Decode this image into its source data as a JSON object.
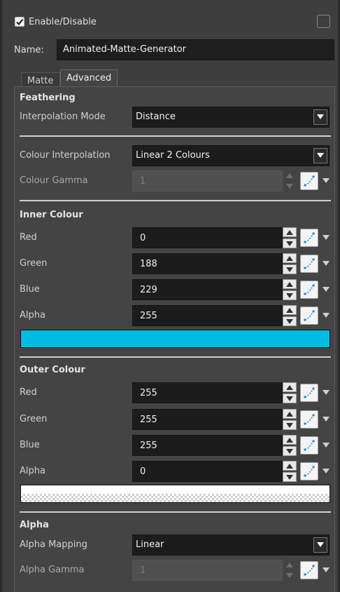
{
  "header": {
    "enable_label": "Enable/Disable",
    "enable_checked": true,
    "name_label": "Name:",
    "name_value": "Animated-Matte-Generator"
  },
  "tabs": [
    {
      "label": "Matte",
      "active": false
    },
    {
      "label": "Advanced",
      "active": true
    }
  ],
  "feathering": {
    "title": "Feathering",
    "interpolation_mode_label": "Interpolation Mode",
    "interpolation_mode_value": "Distance"
  },
  "colour": {
    "interpolation_label": "Colour Interpolation",
    "interpolation_value": "Linear 2 Colours",
    "gamma_label": "Colour Gamma",
    "gamma_value": "1"
  },
  "inner_colour": {
    "title": "Inner Colour",
    "red_label": "Red",
    "red": "0",
    "green_label": "Green",
    "green": "188",
    "blue_label": "Blue",
    "blue": "229",
    "alpha_label": "Alpha",
    "alpha": "255",
    "swatch_color": "#00bce5"
  },
  "outer_colour": {
    "title": "Outer Colour",
    "red_label": "Red",
    "red": "255",
    "green_label": "Green",
    "green": "255",
    "blue_label": "Blue",
    "blue": "255",
    "alpha_label": "Alpha",
    "alpha": "0",
    "swatch_color": "#ffffff"
  },
  "alpha": {
    "title": "Alpha",
    "mapping_label": "Alpha Mapping",
    "mapping_value": "Linear",
    "gamma_label": "Alpha Gamma",
    "gamma_value": "1"
  },
  "icons": {
    "checkbox": "checkmark-icon",
    "dropdown": "chevron-down-icon",
    "function": "function-curve-icon",
    "spin_up": "arrow-up-icon",
    "spin_down": "arrow-down-icon"
  },
  "colors": {
    "accent_blue": "#2f7fd6"
  }
}
